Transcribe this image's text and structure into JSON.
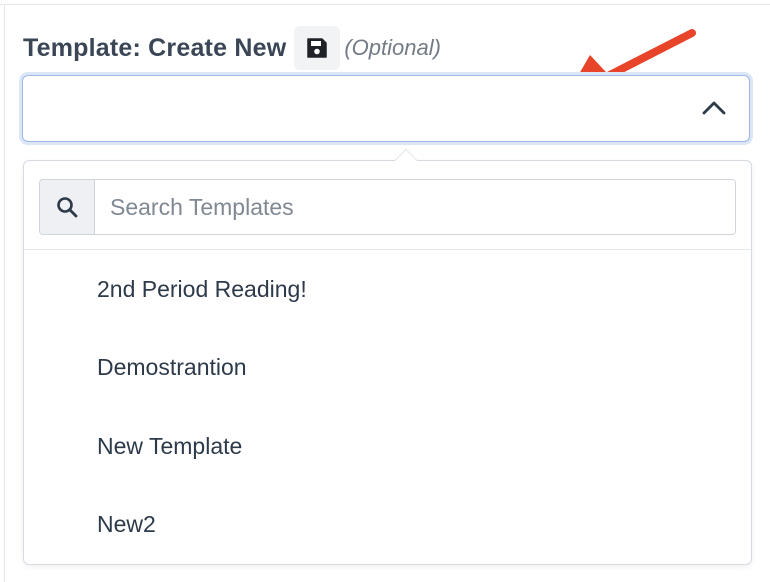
{
  "template_field": {
    "label": "Template: Create New",
    "save_icon": "floppy-disk-icon",
    "optional_label": "(Optional)",
    "selected_value": "",
    "expanded": true
  },
  "dropdown": {
    "search": {
      "icon": "search-icon",
      "placeholder": "Search Templates",
      "value": ""
    },
    "options": [
      {
        "label": "2nd Period Reading!"
      },
      {
        "label": "Demostrantion"
      },
      {
        "label": "New Template"
      },
      {
        "label": "New2"
      }
    ]
  },
  "annotation": {
    "arrow_color": "#e8442a"
  },
  "colors": {
    "focus_border": "#9fb9e6",
    "text": "#2d3a4a"
  }
}
